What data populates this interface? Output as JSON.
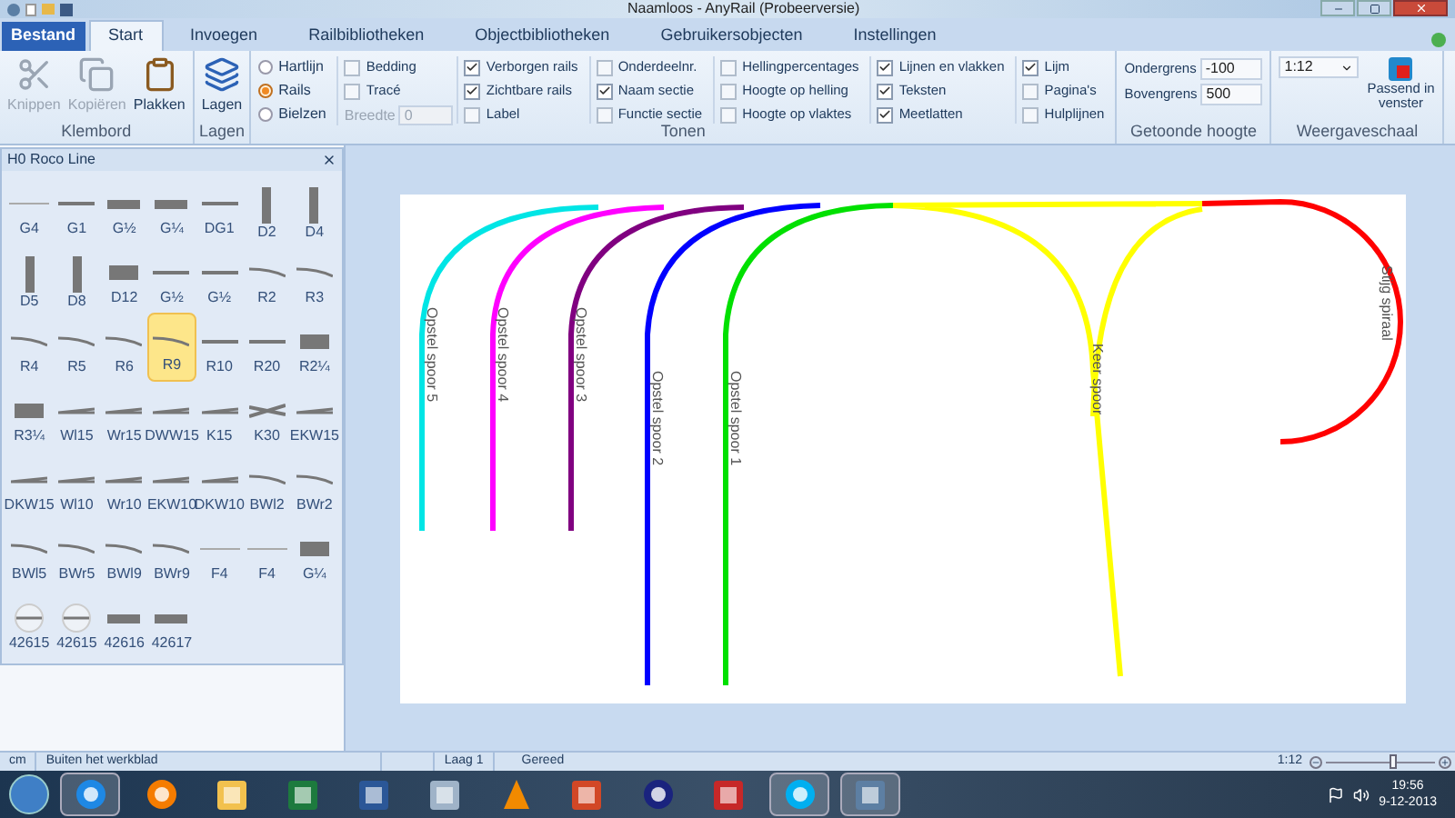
{
  "window": {
    "title": "Naamloos - AnyRail (Probeerversie)"
  },
  "tabs": [
    {
      "label": "Bestand",
      "kind": "file",
      "selected": false
    },
    {
      "label": "Start",
      "kind": "tab",
      "selected": true
    },
    {
      "label": "Invoegen",
      "kind": "tab",
      "selected": false
    },
    {
      "label": "Railbibliotheken",
      "kind": "tab",
      "selected": false
    },
    {
      "label": "Objectbibliotheken",
      "kind": "tab",
      "selected": false
    },
    {
      "label": "Gebruikersobjecten",
      "kind": "tab",
      "selected": false
    },
    {
      "label": "Instellingen",
      "kind": "tab",
      "selected": false
    }
  ],
  "ribbon": {
    "klembord": {
      "label": "Klembord",
      "buttons": [
        {
          "label": "Knippen",
          "kind": "cut",
          "disabled": true
        },
        {
          "label": "Kopiëren",
          "kind": "copy",
          "disabled": true
        },
        {
          "label": "Plakken",
          "kind": "paste",
          "disabled": false
        }
      ]
    },
    "lagen": {
      "label": "Lagen",
      "button": "Lagen"
    },
    "tonen": {
      "label": "Tonen",
      "radios": [
        {
          "label": "Hartlijn",
          "selected": false
        },
        {
          "label": "Rails",
          "selected": true
        },
        {
          "label": "Bielzen",
          "selected": false
        }
      ],
      "columns": [
        [
          {
            "label": "Bedding",
            "checked": false
          },
          {
            "label": "Tracé",
            "checked": false
          }
        ],
        [
          {
            "label": "Verborgen rails",
            "checked": true
          },
          {
            "label": "Zichtbare rails",
            "checked": true
          },
          {
            "label": "Label",
            "checked": false
          }
        ],
        [
          {
            "label": "Onderdeelnr.",
            "checked": false
          },
          {
            "label": "Naam sectie",
            "checked": true
          },
          {
            "label": "Functie sectie",
            "checked": false
          }
        ],
        [
          {
            "label": "Hellingpercentages",
            "checked": false
          },
          {
            "label": "Hoogte op helling",
            "checked": false
          },
          {
            "label": "Hoogte op vlaktes",
            "checked": false
          }
        ],
        [
          {
            "label": "Lijnen en vlakken",
            "checked": true
          },
          {
            "label": "Teksten",
            "checked": true
          },
          {
            "label": "Meetlatten",
            "checked": true
          }
        ],
        [
          {
            "label": "Lijm",
            "checked": true
          },
          {
            "label": "Pagina's",
            "checked": false
          },
          {
            "label": "Hulplijnen",
            "checked": false
          }
        ]
      ],
      "width_field": {
        "label": "Breedte",
        "value": "0",
        "disabled": true
      }
    },
    "hoogte": {
      "label": "Getoonde hoogte",
      "fields": [
        {
          "label": "Ondergrens",
          "value": "-100"
        },
        {
          "label": "Bovengrens",
          "value": "500"
        }
      ]
    },
    "schaal": {
      "label": "Weergaveschaal",
      "value": "1:12",
      "button": "Passend in venster"
    }
  },
  "panel": {
    "title": "H0 Roco Line",
    "items": [
      {
        "label": "G4",
        "kind": "thin",
        "selected": false
      },
      {
        "label": "G1",
        "kind": "straight",
        "selected": false
      },
      {
        "label": "G½",
        "kind": "thick",
        "selected": false
      },
      {
        "label": "G¼",
        "kind": "thick",
        "selected": false
      },
      {
        "label": "DG1",
        "kind": "straight",
        "selected": false
      },
      {
        "label": "D2",
        "kind": "vertical",
        "selected": false
      },
      {
        "label": "D4",
        "kind": "vertical",
        "selected": false
      },
      {
        "label": "D5",
        "kind": "vertical",
        "selected": false
      },
      {
        "label": "D8",
        "kind": "vertical",
        "selected": false
      },
      {
        "label": "D12",
        "kind": "block",
        "selected": false
      },
      {
        "label": "G½",
        "kind": "straight",
        "selected": false
      },
      {
        "label": "G½",
        "kind": "straight",
        "selected": false
      },
      {
        "label": "R2",
        "kind": "curve",
        "selected": false
      },
      {
        "label": "R3",
        "kind": "curve",
        "selected": false
      },
      {
        "label": "R4",
        "kind": "curve",
        "selected": false
      },
      {
        "label": "R5",
        "kind": "curve",
        "selected": false
      },
      {
        "label": "R6",
        "kind": "curve",
        "selected": false
      },
      {
        "label": "R9",
        "kind": "curve",
        "selected": true
      },
      {
        "label": "R10",
        "kind": "straight",
        "selected": false
      },
      {
        "label": "R20",
        "kind": "straight",
        "selected": false
      },
      {
        "label": "R2¼",
        "kind": "block",
        "selected": false
      },
      {
        "label": "R3¼",
        "kind": "block",
        "selected": false
      },
      {
        "label": "Wl15",
        "kind": "turnout",
        "selected": false
      },
      {
        "label": "Wr15",
        "kind": "turnout",
        "selected": false
      },
      {
        "label": "DWW15",
        "kind": "turnout",
        "selected": false
      },
      {
        "label": "K15",
        "kind": "turnout",
        "selected": false
      },
      {
        "label": "K30",
        "kind": "crossing",
        "selected": false
      },
      {
        "label": "EKW15",
        "kind": "turnout",
        "selected": false
      },
      {
        "label": "DKW15",
        "kind": "turnout",
        "selected": false
      },
      {
        "label": "Wl10",
        "kind": "turnout",
        "selected": false
      },
      {
        "label": "Wr10",
        "kind": "turnout",
        "selected": false
      },
      {
        "label": "EKW10",
        "kind": "turnout",
        "selected": false
      },
      {
        "label": "DKW10",
        "kind": "turnout",
        "selected": false
      },
      {
        "label": "BWl2",
        "kind": "curve",
        "selected": false
      },
      {
        "label": "BWr2",
        "kind": "curve",
        "selected": false
      },
      {
        "label": "BWl5",
        "kind": "curve",
        "selected": false
      },
      {
        "label": "BWr5",
        "kind": "curve",
        "selected": false
      },
      {
        "label": "BWl9",
        "kind": "curve",
        "selected": false
      },
      {
        "label": "BWr9",
        "kind": "curve",
        "selected": false
      },
      {
        "label": "F4",
        "kind": "thin",
        "selected": false
      },
      {
        "label": "F4",
        "kind": "thin",
        "selected": false
      },
      {
        "label": "G¼",
        "kind": "block",
        "selected": false
      },
      {
        "label": "42615",
        "kind": "circle",
        "selected": false
      },
      {
        "label": "42615",
        "kind": "circle",
        "selected": false
      },
      {
        "label": "42616",
        "kind": "thick",
        "selected": false
      },
      {
        "label": "42617",
        "kind": "thick",
        "selected": false
      }
    ]
  },
  "layout": {
    "tracks": [
      {
        "label": "Opstel spoor 5",
        "color": "#00e5e5"
      },
      {
        "label": "Opstel spoor 4",
        "color": "#ff00ff"
      },
      {
        "label": "Opstel spoor 3",
        "color": "#800080"
      },
      {
        "label": "Opstel spoor 2",
        "color": "#0000ff"
      },
      {
        "label": "Opstel spoor 1",
        "color": "#00e000"
      },
      {
        "label": "Keer spoor",
        "color": "#ffff00"
      },
      {
        "label": "Stijg spiraal",
        "color": "#ff0000"
      }
    ]
  },
  "status_bar": {
    "unit": "cm",
    "position": "Buiten het werkblad",
    "layer": "Laag 1",
    "state": "Gereed",
    "zoom": "1:12",
    "level": 0.62
  },
  "taskbar": {
    "apps": [
      {
        "kind": "ie",
        "selected": true
      },
      {
        "kind": "firefox",
        "selected": false
      },
      {
        "kind": "folder",
        "selected": false
      },
      {
        "kind": "excel",
        "selected": false
      },
      {
        "kind": "word",
        "selected": false
      },
      {
        "kind": "calculator",
        "selected": false
      },
      {
        "kind": "cone",
        "selected": false
      },
      {
        "kind": "powerpoint",
        "selected": false
      },
      {
        "kind": "ring",
        "selected": false
      },
      {
        "kind": "pdf",
        "selected": false
      },
      {
        "kind": "skype",
        "selected": true
      },
      {
        "kind": "anyrail",
        "selected": true
      }
    ],
    "time": "19:56",
    "date": "9-12-2013"
  }
}
